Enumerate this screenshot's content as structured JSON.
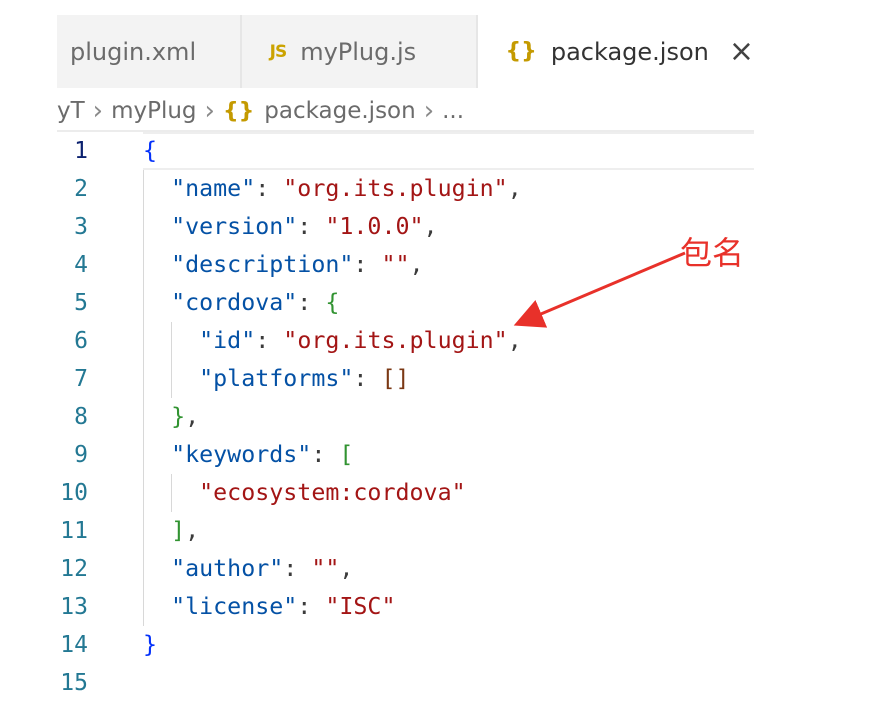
{
  "tabs": [
    {
      "label": "plugin.xml",
      "icon": "none"
    },
    {
      "label": "myPlug.js",
      "icon": "js-icon",
      "icon_text": "JS"
    },
    {
      "label": "package.json",
      "icon": "json-icon",
      "icon_text": "{}",
      "active": true,
      "close": "×"
    }
  ],
  "breadcrumb": {
    "items": [
      "yT",
      "myPlug",
      "package.json",
      "..."
    ],
    "json_icon_text": "{}"
  },
  "editor": {
    "active_line": 1,
    "line_numbers": [
      "1",
      "2",
      "3",
      "4",
      "5",
      "6",
      "7",
      "8",
      "9",
      "10",
      "11",
      "12",
      "13",
      "14",
      "15"
    ],
    "lines": [
      "{",
      "  \"name\": \"org.its.plugin\",",
      "  \"version\": \"1.0.0\",",
      "  \"description\": \"\",",
      "  \"cordova\": {",
      "    \"id\": \"org.its.plugin\",",
      "    \"platforms\": []",
      "  },",
      "  \"keywords\": [",
      "    \"ecosystem:cordova\"",
      "  ],",
      "  \"author\": \"\",",
      "  \"license\": \"ISC\"",
      "}",
      ""
    ]
  },
  "annotation": {
    "text": "包名",
    "color": "#e8312a"
  },
  "colors": {
    "key": "#0451a5",
    "string": "#a31515",
    "line_number": "#237893",
    "bracket_level1": "#0431fa",
    "bracket_level2": "#319331",
    "bracket_level3": "#7b3814"
  }
}
